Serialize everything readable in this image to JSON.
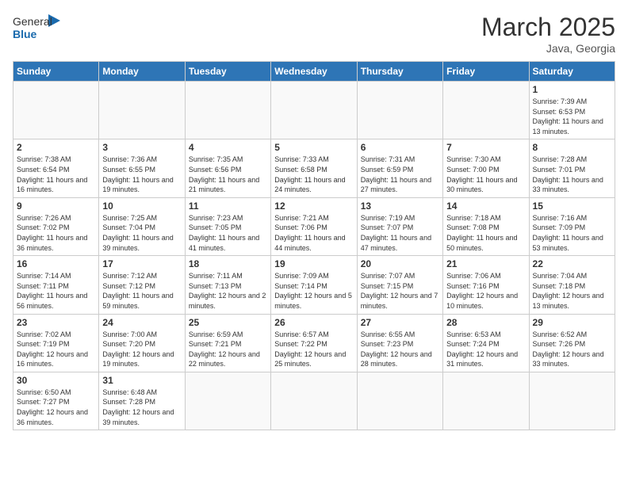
{
  "header": {
    "logo_general": "General",
    "logo_blue": "Blue",
    "month_title": "March 2025",
    "location": "Java, Georgia"
  },
  "days_of_week": [
    "Sunday",
    "Monday",
    "Tuesday",
    "Wednesday",
    "Thursday",
    "Friday",
    "Saturday"
  ],
  "weeks": [
    [
      {
        "day": "",
        "info": ""
      },
      {
        "day": "",
        "info": ""
      },
      {
        "day": "",
        "info": ""
      },
      {
        "day": "",
        "info": ""
      },
      {
        "day": "",
        "info": ""
      },
      {
        "day": "",
        "info": ""
      },
      {
        "day": "1",
        "info": "Sunrise: 7:39 AM\nSunset: 6:53 PM\nDaylight: 11 hours and 13 minutes."
      }
    ],
    [
      {
        "day": "2",
        "info": "Sunrise: 7:38 AM\nSunset: 6:54 PM\nDaylight: 11 hours and 16 minutes."
      },
      {
        "day": "3",
        "info": "Sunrise: 7:36 AM\nSunset: 6:55 PM\nDaylight: 11 hours and 19 minutes."
      },
      {
        "day": "4",
        "info": "Sunrise: 7:35 AM\nSunset: 6:56 PM\nDaylight: 11 hours and 21 minutes."
      },
      {
        "day": "5",
        "info": "Sunrise: 7:33 AM\nSunset: 6:58 PM\nDaylight: 11 hours and 24 minutes."
      },
      {
        "day": "6",
        "info": "Sunrise: 7:31 AM\nSunset: 6:59 PM\nDaylight: 11 hours and 27 minutes."
      },
      {
        "day": "7",
        "info": "Sunrise: 7:30 AM\nSunset: 7:00 PM\nDaylight: 11 hours and 30 minutes."
      },
      {
        "day": "8",
        "info": "Sunrise: 7:28 AM\nSunset: 7:01 PM\nDaylight: 11 hours and 33 minutes."
      }
    ],
    [
      {
        "day": "9",
        "info": "Sunrise: 7:26 AM\nSunset: 7:02 PM\nDaylight: 11 hours and 36 minutes."
      },
      {
        "day": "10",
        "info": "Sunrise: 7:25 AM\nSunset: 7:04 PM\nDaylight: 11 hours and 39 minutes."
      },
      {
        "day": "11",
        "info": "Sunrise: 7:23 AM\nSunset: 7:05 PM\nDaylight: 11 hours and 41 minutes."
      },
      {
        "day": "12",
        "info": "Sunrise: 7:21 AM\nSunset: 7:06 PM\nDaylight: 11 hours and 44 minutes."
      },
      {
        "day": "13",
        "info": "Sunrise: 7:19 AM\nSunset: 7:07 PM\nDaylight: 11 hours and 47 minutes."
      },
      {
        "day": "14",
        "info": "Sunrise: 7:18 AM\nSunset: 7:08 PM\nDaylight: 11 hours and 50 minutes."
      },
      {
        "day": "15",
        "info": "Sunrise: 7:16 AM\nSunset: 7:09 PM\nDaylight: 11 hours and 53 minutes."
      }
    ],
    [
      {
        "day": "16",
        "info": "Sunrise: 7:14 AM\nSunset: 7:11 PM\nDaylight: 11 hours and 56 minutes."
      },
      {
        "day": "17",
        "info": "Sunrise: 7:12 AM\nSunset: 7:12 PM\nDaylight: 11 hours and 59 minutes."
      },
      {
        "day": "18",
        "info": "Sunrise: 7:11 AM\nSunset: 7:13 PM\nDaylight: 12 hours and 2 minutes."
      },
      {
        "day": "19",
        "info": "Sunrise: 7:09 AM\nSunset: 7:14 PM\nDaylight: 12 hours and 5 minutes."
      },
      {
        "day": "20",
        "info": "Sunrise: 7:07 AM\nSunset: 7:15 PM\nDaylight: 12 hours and 7 minutes."
      },
      {
        "day": "21",
        "info": "Sunrise: 7:06 AM\nSunset: 7:16 PM\nDaylight: 12 hours and 10 minutes."
      },
      {
        "day": "22",
        "info": "Sunrise: 7:04 AM\nSunset: 7:18 PM\nDaylight: 12 hours and 13 minutes."
      }
    ],
    [
      {
        "day": "23",
        "info": "Sunrise: 7:02 AM\nSunset: 7:19 PM\nDaylight: 12 hours and 16 minutes."
      },
      {
        "day": "24",
        "info": "Sunrise: 7:00 AM\nSunset: 7:20 PM\nDaylight: 12 hours and 19 minutes."
      },
      {
        "day": "25",
        "info": "Sunrise: 6:59 AM\nSunset: 7:21 PM\nDaylight: 12 hours and 22 minutes."
      },
      {
        "day": "26",
        "info": "Sunrise: 6:57 AM\nSunset: 7:22 PM\nDaylight: 12 hours and 25 minutes."
      },
      {
        "day": "27",
        "info": "Sunrise: 6:55 AM\nSunset: 7:23 PM\nDaylight: 12 hours and 28 minutes."
      },
      {
        "day": "28",
        "info": "Sunrise: 6:53 AM\nSunset: 7:24 PM\nDaylight: 12 hours and 31 minutes."
      },
      {
        "day": "29",
        "info": "Sunrise: 6:52 AM\nSunset: 7:26 PM\nDaylight: 12 hours and 33 minutes."
      }
    ],
    [
      {
        "day": "30",
        "info": "Sunrise: 6:50 AM\nSunset: 7:27 PM\nDaylight: 12 hours and 36 minutes."
      },
      {
        "day": "31",
        "info": "Sunrise: 6:48 AM\nSunset: 7:28 PM\nDaylight: 12 hours and 39 minutes."
      },
      {
        "day": "",
        "info": ""
      },
      {
        "day": "",
        "info": ""
      },
      {
        "day": "",
        "info": ""
      },
      {
        "day": "",
        "info": ""
      },
      {
        "day": "",
        "info": ""
      }
    ]
  ]
}
